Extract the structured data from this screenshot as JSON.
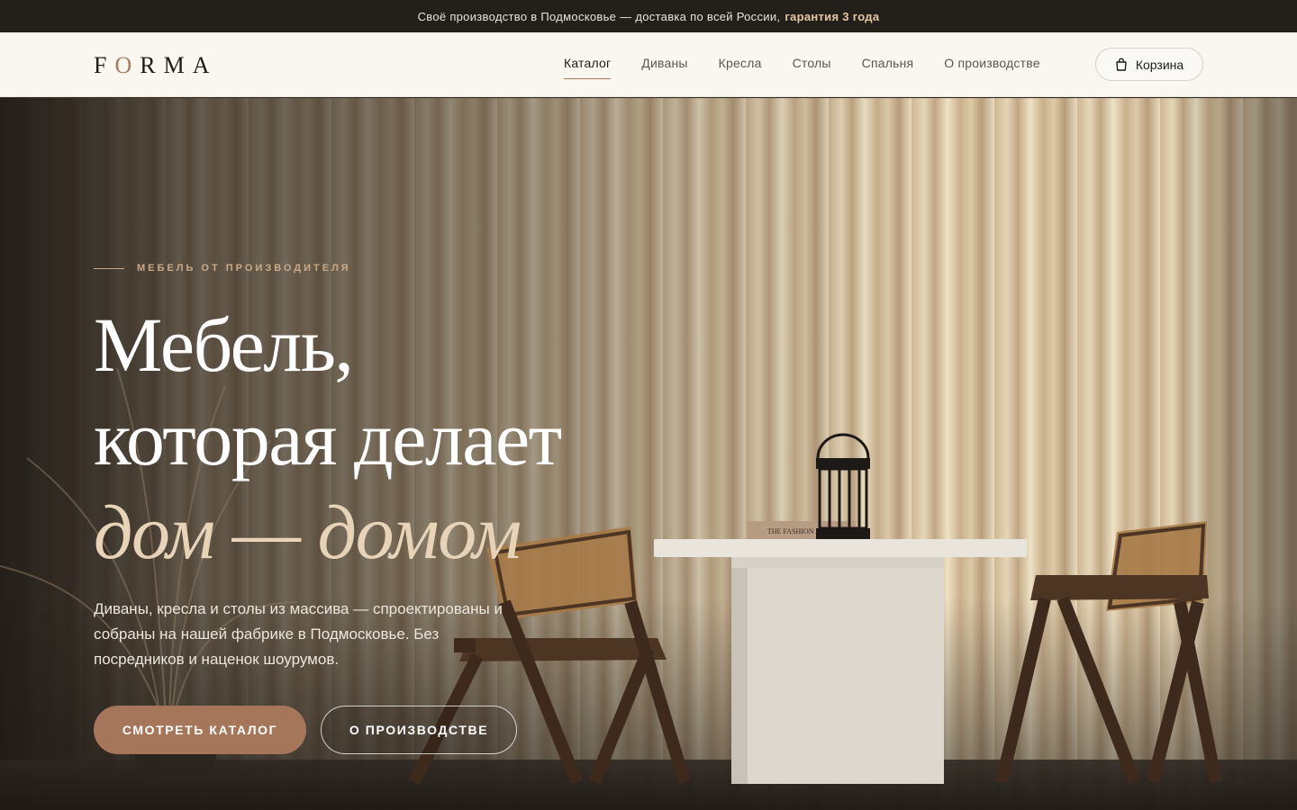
{
  "announcement": {
    "text": "Своё производство в Подмосковье — доставка по всей России,",
    "highlight": "гарантия 3 года"
  },
  "header": {
    "logo": {
      "before": "F",
      "accent": "O",
      "after": "RMA"
    },
    "nav": [
      {
        "label": "Каталог",
        "active": true
      },
      {
        "label": "Диваны",
        "active": false
      },
      {
        "label": "Кресла",
        "active": false
      },
      {
        "label": "Столы",
        "active": false
      },
      {
        "label": "Спальня",
        "active": false
      },
      {
        "label": "О производстве",
        "active": false
      }
    ],
    "cart": {
      "label": "Корзина",
      "icon": "shopping-bag-icon"
    }
  },
  "hero": {
    "eyebrow": "МЕБЕЛЬ ОТ ПРОИЗВОДИТЕЛЯ",
    "headline": {
      "line1": "Мебель,",
      "line2": "которая делает",
      "line3": "дом — домом"
    },
    "lead": "Диваны, кресла и столы из массива — спроектированы и собраны на нашей фабрике в Подмосковье. Без посредников и наценок шоурумов.",
    "primary_button": "СМОТРЕТЬ КАТАЛОГ",
    "secondary_button": "О ПРОИЗВОДСТВЕ",
    "book_title": "THE FASHION BOOK"
  },
  "colors": {
    "accent": "#a6765a",
    "announcement_bg": "#23201c",
    "header_bg": "#faf7f1",
    "headline_accent": "#e7d3b8"
  }
}
